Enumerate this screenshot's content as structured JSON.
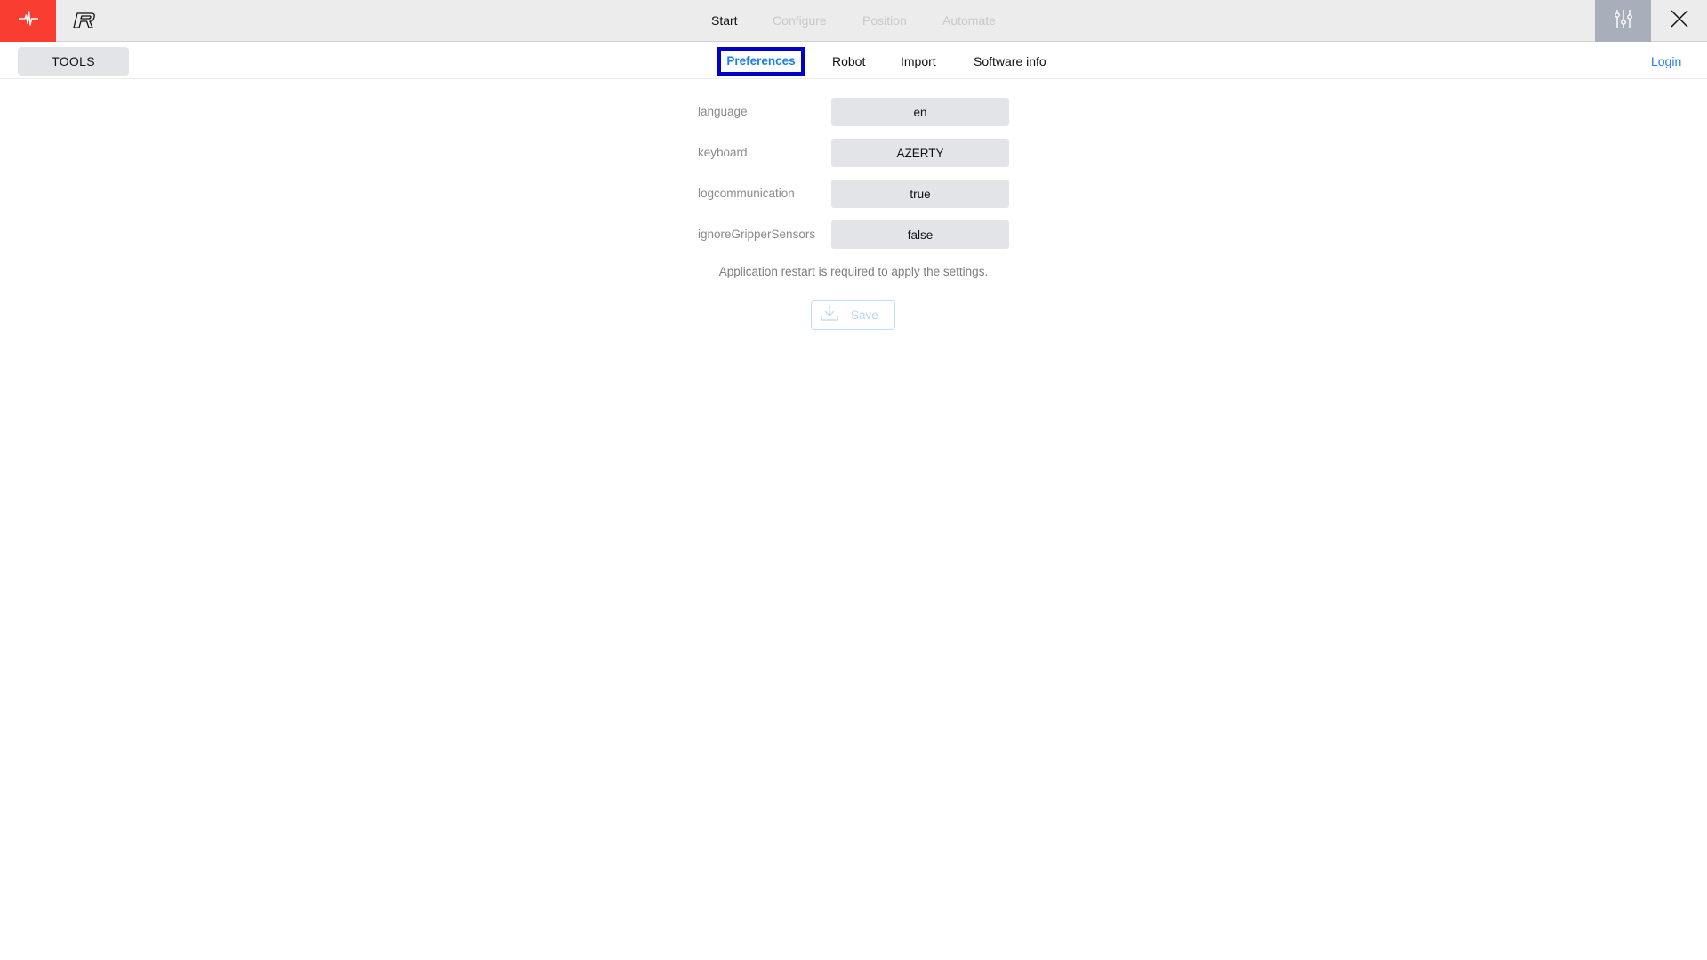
{
  "header": {
    "logo_icon": "heartbeat-icon",
    "brand_icon": "r-brand-icon",
    "nav": [
      {
        "label": "Start",
        "state": "active"
      },
      {
        "label": "Configure",
        "state": "disabled"
      },
      {
        "label": "Position",
        "state": "disabled"
      },
      {
        "label": "Automate",
        "state": "disabled"
      }
    ],
    "settings_icon": "sliders-icon",
    "close_icon": "close-icon"
  },
  "subbar": {
    "tools_label": "TOOLS",
    "tabs": [
      {
        "label": "Preferences",
        "active": true
      },
      {
        "label": "Robot",
        "active": false
      },
      {
        "label": "Import",
        "active": false
      },
      {
        "label": "Software info",
        "active": false
      }
    ],
    "login_label": "Login"
  },
  "preferences": {
    "rows": [
      {
        "label": "language",
        "value": "en"
      },
      {
        "label": "keyboard",
        "value": "AZERTY"
      },
      {
        "label": "logcommunication",
        "value": "true"
      },
      {
        "label": "ignoreGripperSensors",
        "value": "false"
      }
    ],
    "note": "Application restart is required to apply the settings.",
    "save_label": "Save",
    "save_icon": "download-icon",
    "save_enabled": false
  },
  "colors": {
    "brand_red": "#fa3d31",
    "accent_blue": "#1a7ff0",
    "focus_outline": "#0000c8",
    "settings_bg": "#a9afba"
  }
}
